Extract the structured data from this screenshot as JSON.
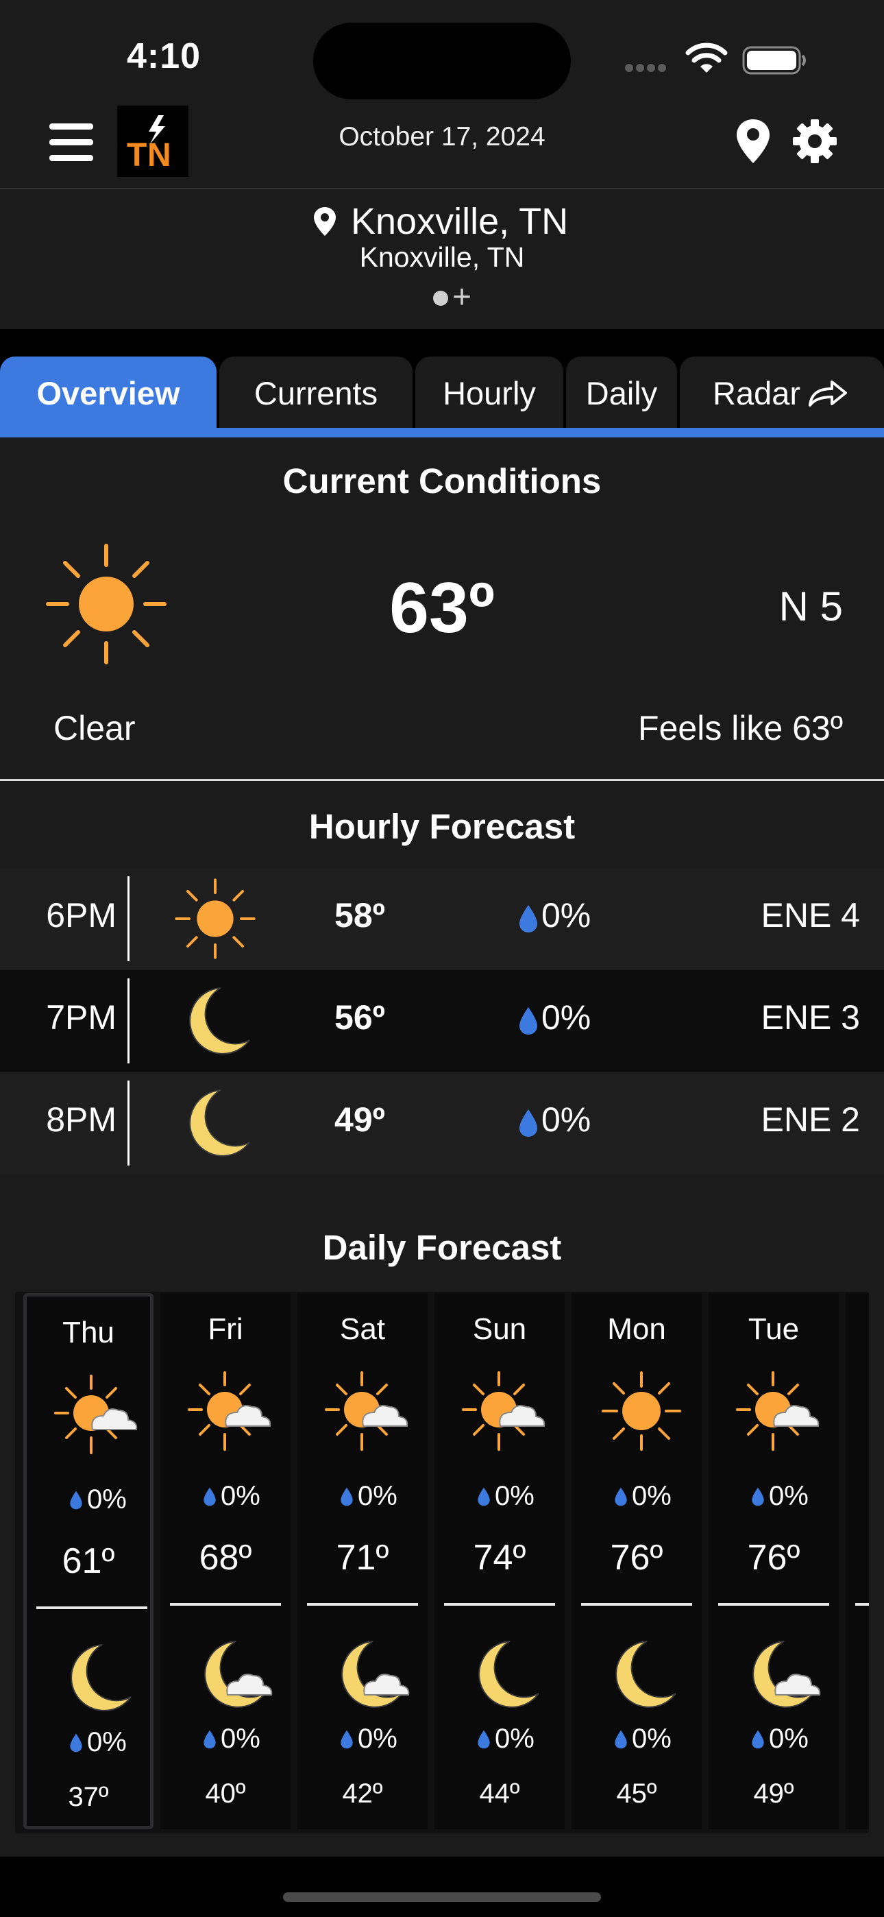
{
  "status_bar": {
    "time": "4:10"
  },
  "header": {
    "date": "October 17, 2024"
  },
  "location": {
    "name": "Knoxville, TN",
    "subtitle": "Knoxville, TN",
    "add_label": "+"
  },
  "tabs": [
    {
      "label": "Overview",
      "active": true
    },
    {
      "label": "Currents"
    },
    {
      "label": "Hourly"
    },
    {
      "label": "Daily"
    },
    {
      "label": "Radar"
    }
  ],
  "current": {
    "title": "Current Conditions",
    "icon": "sun-icon",
    "temp": "63º",
    "wind": "N 5",
    "condition": "Clear",
    "feels_like": "Feels like 63º"
  },
  "hourly": {
    "title": "Hourly Forecast",
    "rows": [
      {
        "time": "6PM",
        "icon": "sun-icon",
        "temp": "58º",
        "precip": "0%",
        "wind": "ENE 4"
      },
      {
        "time": "7PM",
        "icon": "moon-icon",
        "temp": "56º",
        "precip": "0%",
        "wind": "ENE 3"
      },
      {
        "time": "8PM",
        "icon": "moon-icon",
        "temp": "49º",
        "precip": "0%",
        "wind": "ENE 2"
      }
    ]
  },
  "daily": {
    "title": "Daily Forecast",
    "days": [
      {
        "day": "Thu",
        "day_icon": "partly-cloudy-icon",
        "day_precip": "0%",
        "high": "61º",
        "night_icon": "moon-icon",
        "night_precip": "0%",
        "low": "37º"
      },
      {
        "day": "Fri",
        "day_icon": "partly-cloudy-icon",
        "day_precip": "0%",
        "high": "68º",
        "night_icon": "moon-cloud-icon",
        "night_precip": "0%",
        "low": "40º"
      },
      {
        "day": "Sat",
        "day_icon": "partly-cloudy-icon",
        "day_precip": "0%",
        "high": "71º",
        "night_icon": "moon-cloud-icon",
        "night_precip": "0%",
        "low": "42º"
      },
      {
        "day": "Sun",
        "day_icon": "partly-cloudy-icon",
        "day_precip": "0%",
        "high": "74º",
        "night_icon": "moon-icon",
        "night_precip": "0%",
        "low": "44º"
      },
      {
        "day": "Mon",
        "day_icon": "sun-icon",
        "day_precip": "0%",
        "high": "76º",
        "night_icon": "moon-icon",
        "night_precip": "0%",
        "low": "45º"
      },
      {
        "day": "Tue",
        "day_icon": "partly-cloudy-icon",
        "day_precip": "0%",
        "high": "76º",
        "night_icon": "moon-cloud-icon",
        "night_precip": "0%",
        "low": "49º"
      }
    ]
  },
  "colors": {
    "accent": "#3d7ae0",
    "sun": "#fba43a",
    "moon": "#f6d66c",
    "drop": "#3d7ae0",
    "logo_orange": "#f58a1f"
  }
}
